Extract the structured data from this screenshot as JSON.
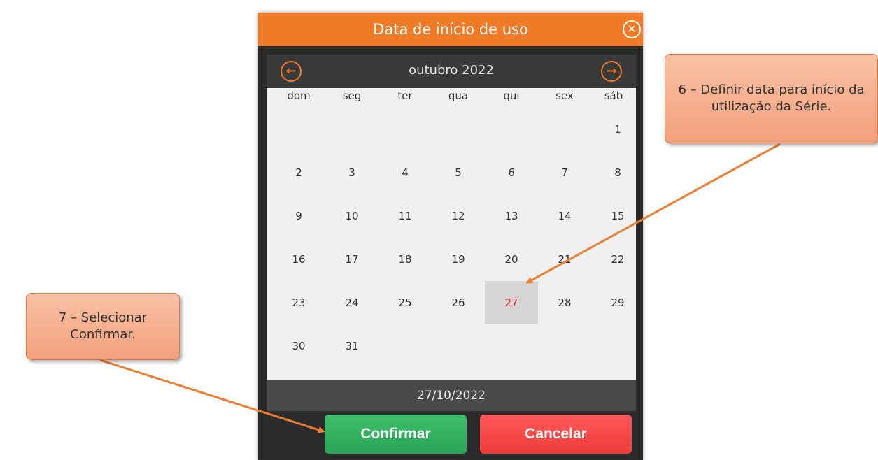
{
  "dialog": {
    "title": "Data de início de uso",
    "close_icon": "close-icon"
  },
  "calendar": {
    "month_label": "outubro 2022",
    "prev_icon": "arrow-left-icon",
    "next_icon": "arrow-right-icon",
    "weekdays": [
      "dom",
      "seg",
      "ter",
      "qua",
      "qui",
      "sex",
      "sáb"
    ],
    "first_weekday_index": 6,
    "days_in_month": 31,
    "selected_day": "27",
    "selected_date": "27/10/2022",
    "selected_color": "#e3242b"
  },
  "buttons": {
    "confirm_label": "Confirmar",
    "cancel_label": "Cancelar",
    "confirm_color": "#2ba85a",
    "cancel_color": "#f04545"
  },
  "callouts": {
    "step6": "6 – Definir data para início da utilização da Série.",
    "step7": "7 – Selecionar Confirmar."
  },
  "colors": {
    "accent": "#f07a26",
    "dialog_bg": "#2b2b2b"
  }
}
